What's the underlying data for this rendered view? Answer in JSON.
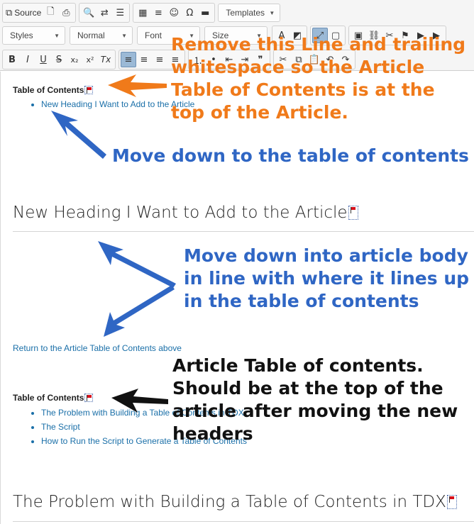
{
  "toolbar": {
    "source_label": "Source",
    "templates_label": "Templates",
    "styles_label": "Styles",
    "format_label": "Normal",
    "font_label": "Font",
    "size_label": "Size",
    "bold": "B",
    "italic": "I",
    "underline": "U",
    "strike": "S",
    "subscript": "x₂",
    "superscript": "x²",
    "remove_format": "Tx"
  },
  "editor": {
    "toc_title": "Table of Contents",
    "toc1_items": [
      "New Heading I Want to Add to the Article"
    ],
    "heading_new": "New Heading I Want to Add to the Article",
    "return_link": "Return to the Article Table of Contents above",
    "toc2_items": [
      "The Problem with Building a Table of Contents in TDX",
      "The Script",
      "How to Run the Script to Generate a Table of Contents"
    ],
    "heading_problem": "The Problem with Building a Table of Contents in TDX"
  },
  "annotations": {
    "orange_note": "Remove this Line and trailing\nwhitespace so the Article\nTable of Contents is at the\ntop of the Article.",
    "blue_note_1": "Move down to the table of contents",
    "blue_note_2": "Move down into article body\nin line with where it lines up\nin the table of contents",
    "black_note": "Article Table of contents.\nShould be at the top of the\narticle after moving the new\nheaders",
    "colors": {
      "orange": "#f07a1a",
      "blue": "#2f66c4",
      "black": "#111111",
      "link": "#1a6fa8"
    }
  }
}
